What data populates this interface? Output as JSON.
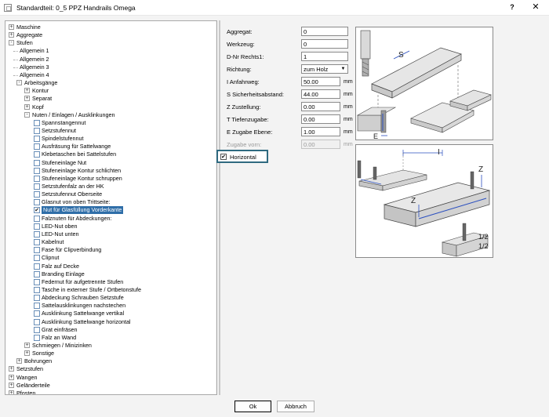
{
  "window": {
    "title": "Standardteil: 0_5 PPZ Handrails Omega",
    "help_label": "?",
    "close_label": "✕"
  },
  "tree": {
    "rows": [
      {
        "label": "Maschine",
        "kind": "expand",
        "sign": "+",
        "level": 0
      },
      {
        "label": "Aggregate",
        "kind": "expand",
        "sign": "+",
        "level": 0
      },
      {
        "label": "Stufen",
        "kind": "expand",
        "sign": "-",
        "level": 0
      },
      {
        "label": "Allgemein  1",
        "kind": "leaf",
        "level": 1
      },
      {
        "label": "Allgemein  2",
        "kind": "leaf",
        "level": 1
      },
      {
        "label": "Allgemein  3",
        "kind": "leaf",
        "level": 1
      },
      {
        "label": "Allgemein  4",
        "kind": "leaf",
        "level": 1
      },
      {
        "label": "Arbeitsgänge",
        "kind": "expand",
        "sign": "-",
        "level": 1
      },
      {
        "label": "Kontur",
        "kind": "expand",
        "sign": "+",
        "level": 2
      },
      {
        "label": "Separat",
        "kind": "expand",
        "sign": "+",
        "level": 2
      },
      {
        "label": "Kopf",
        "kind": "expand",
        "sign": "+",
        "level": 2
      },
      {
        "label": "Nuten / Einlagen / Ausklinkungen",
        "kind": "expand",
        "sign": "-",
        "level": 2
      },
      {
        "label": "Spannstangennut",
        "kind": "check",
        "checked": false,
        "level": 3
      },
      {
        "label": "Setzstufennut",
        "kind": "check",
        "checked": false,
        "level": 3
      },
      {
        "label": "Spindelstufennut",
        "kind": "check",
        "checked": false,
        "level": 3
      },
      {
        "label": "Ausfräsung für Sattelwange",
        "kind": "check",
        "checked": false,
        "level": 3
      },
      {
        "label": "Klebetaschen bei Sattelstufen",
        "kind": "check",
        "checked": false,
        "level": 3
      },
      {
        "label": "Stufeneinlage Nut",
        "kind": "check",
        "checked": false,
        "level": 3
      },
      {
        "label": "Stufeneinlage Kontur schlichten",
        "kind": "check",
        "checked": false,
        "level": 3
      },
      {
        "label": "Stufeneinlage Kontur schruppen",
        "kind": "check",
        "checked": false,
        "level": 3
      },
      {
        "label": "Setzstufenfalz an der HK",
        "kind": "check",
        "checked": false,
        "level": 3
      },
      {
        "label": "Setzstufennut Oberseite",
        "kind": "check",
        "checked": false,
        "level": 3
      },
      {
        "label": "Glasnut von oben Trittseite:",
        "kind": "check",
        "checked": false,
        "level": 3
      },
      {
        "label": "Nut für Glasfüllung Vorderkante",
        "kind": "check",
        "checked": true,
        "selected": true,
        "level": 3
      },
      {
        "label": "Falznuten für Abdeckungen:",
        "kind": "check",
        "checked": false,
        "level": 3
      },
      {
        "label": "LED-Nut oben",
        "kind": "check",
        "checked": false,
        "level": 3
      },
      {
        "label": "LED-Nut unten",
        "kind": "check",
        "checked": false,
        "level": 3
      },
      {
        "label": "Kabelnut",
        "kind": "check",
        "checked": false,
        "level": 3
      },
      {
        "label": "Fase für Clipverbindung",
        "kind": "check",
        "checked": false,
        "level": 3
      },
      {
        "label": "Clipnut",
        "kind": "check",
        "checked": false,
        "level": 3
      },
      {
        "label": "Falz auf Decke",
        "kind": "check",
        "checked": false,
        "level": 3
      },
      {
        "label": "Branding Einlage",
        "kind": "check",
        "checked": false,
        "level": 3
      },
      {
        "label": "Federnut für aufgetrennte Stufen",
        "kind": "check",
        "checked": false,
        "level": 3
      },
      {
        "label": "Tasche in externer Stufe / Ortbetonstufe",
        "kind": "check",
        "checked": false,
        "level": 3
      },
      {
        "label": "Abdeckung Schrauben Setzstufe",
        "kind": "check",
        "checked": false,
        "level": 3
      },
      {
        "label": "Sattelausklinkungen nachstechen",
        "kind": "check",
        "checked": false,
        "level": 3
      },
      {
        "label": "Ausklinkung Sattelwange vertikal",
        "kind": "check",
        "checked": false,
        "level": 3
      },
      {
        "label": "Ausklinkung Sattelwange horizontal",
        "kind": "check",
        "checked": false,
        "level": 3
      },
      {
        "label": "Grat einfräsen",
        "kind": "check",
        "checked": false,
        "level": 3
      },
      {
        "label": "Falz an Wand",
        "kind": "check",
        "checked": false,
        "level": 3
      },
      {
        "label": "Schmiegen / Minizinken",
        "kind": "expand",
        "sign": "+",
        "level": 2
      },
      {
        "label": "Sonstige",
        "kind": "expand",
        "sign": "+",
        "level": 2
      },
      {
        "label": "Bohrungen",
        "kind": "expand",
        "sign": "+",
        "level": 1
      },
      {
        "label": "Setzstufen",
        "kind": "expand",
        "sign": "+",
        "level": 0
      },
      {
        "label": "Wangen",
        "kind": "expand",
        "sign": "+",
        "level": 0
      },
      {
        "label": "Geländerteile",
        "kind": "expand",
        "sign": "+",
        "level": 0
      },
      {
        "label": "Pfosten",
        "kind": "expand",
        "sign": "+",
        "level": 0
      }
    ]
  },
  "form": {
    "fields": [
      {
        "label": "Aggregat:",
        "value": "0",
        "unit": "",
        "disabled": false
      },
      {
        "label": "Werkzeug:",
        "value": "0",
        "unit": "",
        "disabled": false
      },
      {
        "label": "D-Nr Rechts1:",
        "value": "1",
        "unit": "",
        "disabled": false
      },
      {
        "label": "Richtung:",
        "value": "zum Holz",
        "unit": "",
        "disabled": false,
        "select": true
      },
      {
        "label": "I  Anfahrweg:",
        "value": "50.00",
        "unit": "mm",
        "disabled": false
      },
      {
        "label": "S  Sicherheitsabstand:",
        "value": "44.00",
        "unit": "mm",
        "disabled": false
      },
      {
        "label": "Z  Zustellung:",
        "value": "0.00",
        "unit": "mm",
        "disabled": false
      },
      {
        "label": "T  Tiefenzugabe:",
        "value": "0.00",
        "unit": "mm",
        "disabled": false
      },
      {
        "label": "E  Zugabe Ebene:",
        "value": "1.00",
        "unit": "mm",
        "disabled": false
      },
      {
        "label": "Zugabe vorn:",
        "value": "0.00",
        "unit": "mm",
        "disabled": true
      }
    ],
    "horizontal_label": "Horizontal",
    "horizontal_checked": true
  },
  "images": {
    "top_labels": [
      "S",
      "E"
    ],
    "bottom_labels": [
      "I",
      "Z",
      "Z",
      "1/2",
      "1/2"
    ]
  },
  "buttons": {
    "ok_label": "Ok",
    "cancel_label": "Abbruch"
  }
}
